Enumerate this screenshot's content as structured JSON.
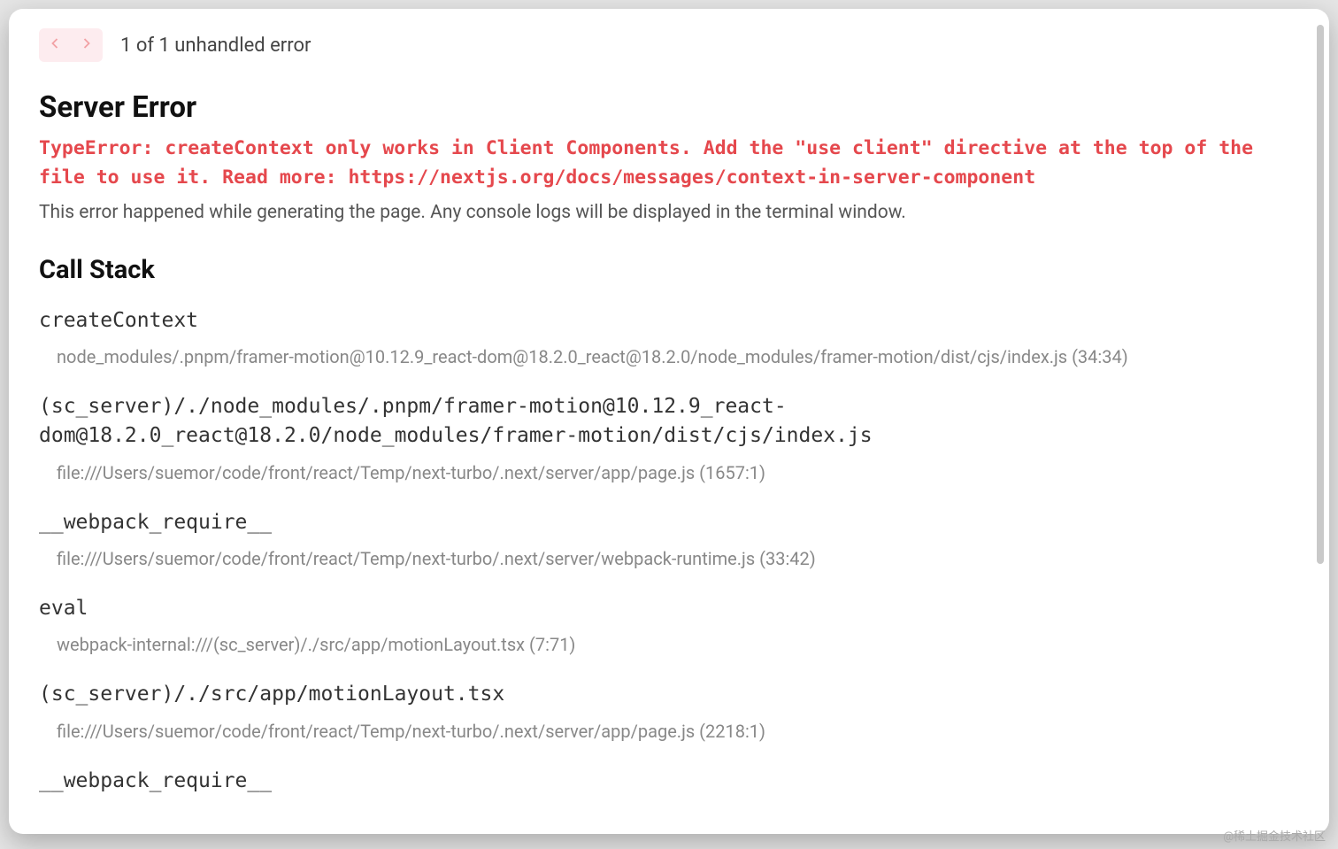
{
  "nav": {
    "prev_enabled": false,
    "next_enabled": false,
    "count_text": "1 of 1 unhandled error"
  },
  "header": {
    "title": "Server Error",
    "message": "TypeError: createContext only works in Client Components. Add the \"use client\" directive at the top of the file to use it. Read more: https://nextjs.org/docs/messages/context-in-server-component",
    "note": "This error happened while generating the page. Any console logs will be displayed in the terminal window."
  },
  "call_stack": {
    "title": "Call Stack",
    "frames": [
      {
        "name": "createContext",
        "location": "node_modules/.pnpm/framer-motion@10.12.9_react-dom@18.2.0_react@18.2.0/node_modules/framer-motion/dist/cjs/index.js (34:34)"
      },
      {
        "name": "(sc_server)/./node_modules/.pnpm/framer-motion@10.12.9_react-dom@18.2.0_react@18.2.0/node_modules/framer-motion/dist/cjs/index.js",
        "location": "file:///Users/suemor/code/front/react/Temp/next-turbo/.next/server/app/page.js (1657:1)"
      },
      {
        "name": "__webpack_require__",
        "location": "file:///Users/suemor/code/front/react/Temp/next-turbo/.next/server/webpack-runtime.js (33:42)"
      },
      {
        "name": "eval",
        "location": "webpack-internal:///(sc_server)/./src/app/motionLayout.tsx (7:71)"
      },
      {
        "name": "(sc_server)/./src/app/motionLayout.tsx",
        "location": "file:///Users/suemor/code/front/react/Temp/next-turbo/.next/server/app/page.js (2218:1)"
      },
      {
        "name": "__webpack_require__",
        "location": ""
      }
    ]
  },
  "watermark": "@稀土掘金技术社区"
}
